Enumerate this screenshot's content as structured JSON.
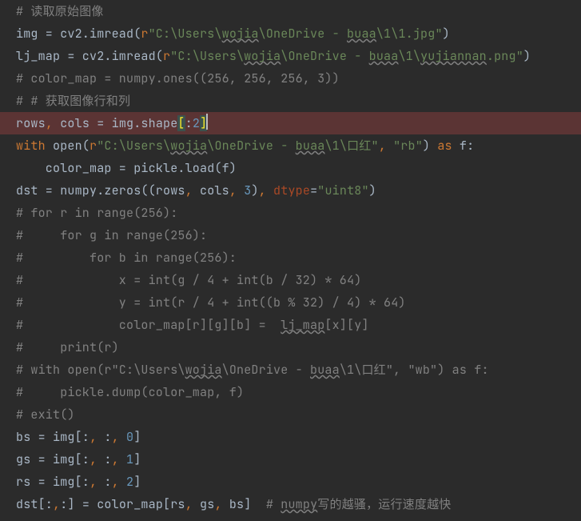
{
  "lines": {
    "c1": "# 读取原始图像",
    "l2": {
      "a": "img = cv2.imread(",
      "r": "r",
      "s": "\"C:\\Users\\",
      "w": "wojia",
      "s2": "\\OneDrive - ",
      "w2": "buaa",
      "s3": "\\1\\1.jpg\"",
      "z": ")"
    },
    "l3": {
      "a": "lj_map = cv2.imread(",
      "r": "r",
      "s": "\"C:\\Users\\",
      "w": "wojia",
      "s2": "\\OneDrive - ",
      "w2": "buaa",
      "s3": "\\1\\",
      "w3": "yujiannan",
      "s4": ".png\"",
      "z": ")"
    },
    "c4": "# color_map = numpy.ones((256, 256, 256, 3))",
    "c5": "# # 获取图像行和列",
    "l6": {
      "a": "rows",
      "c": ", ",
      "b": "cols = img.shape",
      "lb": "[",
      "sep": ":",
      "n": "2",
      "rb": "]"
    },
    "l7": {
      "w1": "with",
      "sp": " ",
      "op": "open",
      "p": "(",
      "r": "r",
      "s": "\"C:\\Users\\",
      "ww": "wojia",
      "s2": "\\OneDrive - ",
      "wb": "buaa",
      "s3": "\\1\\口红\"",
      "c": ", ",
      "rb": "\"rb\"",
      "z": ") ",
      "as": "as",
      "f": " f:"
    },
    "l8": {
      "a": "    color_map = pickle.load(f)"
    },
    "l9": {
      "a": "dst = numpy.zeros((rows",
      "c": ", ",
      "b": "cols",
      "c2": ", ",
      "n": "3",
      "z": ")",
      "c3": ", ",
      "dt": "dtype",
      "eq": "=",
      "ds": "\"uint8\"",
      "z2": ")"
    },
    "c10": "# for r in range(256):",
    "c11": "#     for g in range(256):",
    "c12": "#         for b in range(256):",
    "c13": "#             x = int(g / 4 + int(b / 32) * 64)",
    "c14": "#             y = int(r / 4 + int((b % 32) / 4) * 64)",
    "c15a": "#             color_map[r][g][b] =  ",
    "c15b": "lj_map",
    "c15c": "[x][y]",
    "c16": "#     print(r)",
    "c17a": "# with open(r\"C:\\Users\\",
    "c17w": "wojia",
    "c17b": "\\OneDrive - ",
    "c17w2": "buaa",
    "c17c": "\\1\\口红\", \"wb\") as f:",
    "c18": "#     pickle.dump(color_map, f)",
    "c19": "# exit()",
    "l20": {
      "a": "bs = img[:",
      "c": ", ",
      "b": ":",
      "c2": ", ",
      "n": "0",
      "z": "]"
    },
    "l21": {
      "a": "gs = img[:",
      "c": ", ",
      "b": ":",
      "c2": ", ",
      "n": "1",
      "z": "]"
    },
    "l22": {
      "a": "rs = img[:",
      "c": ", ",
      "b": ":",
      "c2": ", ",
      "n": "2",
      "z": "]"
    },
    "l23": {
      "a": "dst[:",
      "cc": ",",
      "b": ":] = color_map[rs",
      "c": ", ",
      "d": "gs",
      "c2": ", ",
      "e": "bs]  ",
      "cmt1": "# ",
      "cmtw": "numpy",
      "cmt2": "写的越骚，运行速度越快"
    }
  }
}
